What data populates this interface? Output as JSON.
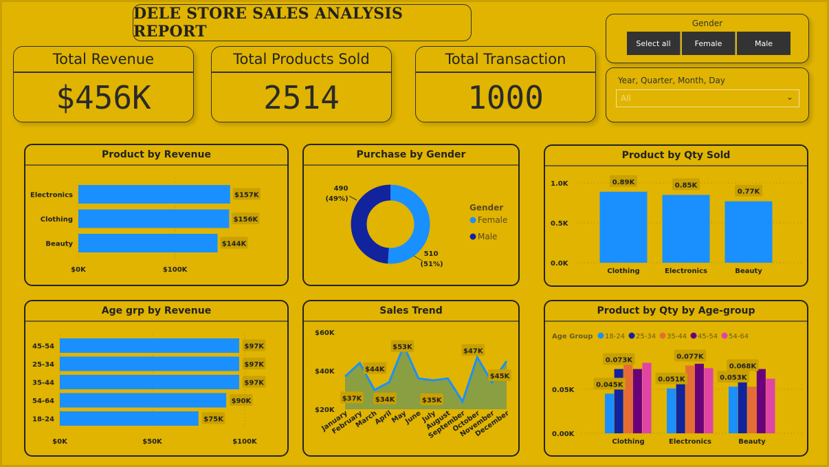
{
  "header": {
    "title": "DELE STORE SALES ANALYSIS REPORT"
  },
  "kpis": [
    {
      "label": "Total Revenue",
      "value": "$456K"
    },
    {
      "label": "Total Products Sold",
      "value": "2514"
    },
    {
      "label": "Total Transaction",
      "value": "1000"
    }
  ],
  "gender_slicer": {
    "title": "Gender",
    "options": [
      "Select all",
      "Female",
      "Male"
    ]
  },
  "date_slicer": {
    "title": "Year, Quarter, Month, Day",
    "selected": "All"
  },
  "colors": {
    "background": "#e0b400",
    "bar_blue": "#1a90ff",
    "navy": "#12239e",
    "orange": "#e66c37",
    "purple": "#6b007b",
    "pink": "#e044a7"
  },
  "chart_data": [
    {
      "type": "bar",
      "orientation": "horizontal",
      "title": "Product by Revenue",
      "categories": [
        "Electronics",
        "Clothing",
        "Beauty"
      ],
      "values": [
        157000,
        156000,
        144000
      ],
      "data_labels": [
        "$157K",
        "$156K",
        "$144K"
      ],
      "xticks": [
        "$0K",
        "$100K"
      ],
      "xlim": [
        0,
        160000
      ],
      "color": "#1a90ff"
    },
    {
      "type": "pie",
      "donut": true,
      "title": "Purchase by Gender",
      "legend_title": "Gender",
      "categories": [
        "Female",
        "Male"
      ],
      "values": [
        510,
        490
      ],
      "data_labels": [
        "510",
        "490"
      ],
      "percent_labels": [
        "(51%)",
        "(49%)"
      ],
      "colors": [
        "#1a90ff",
        "#12239e"
      ],
      "legend": "right"
    },
    {
      "type": "bar",
      "orientation": "vertical",
      "title": "Product by Qty Sold",
      "categories": [
        "Clothing",
        "Electronics",
        "Beauty"
      ],
      "values": [
        890,
        850,
        770
      ],
      "data_labels": [
        "0.89K",
        "0.85K",
        "0.77K"
      ],
      "yticks": [
        "0.0K",
        "0.5K",
        "1.0K"
      ],
      "ylim": [
        0,
        1000
      ],
      "color": "#1a90ff"
    },
    {
      "type": "bar",
      "orientation": "horizontal",
      "title": "Age grp by Revenue",
      "categories": [
        "45-54",
        "25-34",
        "35-44",
        "54-64",
        "18-24"
      ],
      "values": [
        97000,
        97000,
        97000,
        90000,
        75000
      ],
      "data_labels": [
        "$97K",
        "$97K",
        "$97K",
        "$90K",
        "$75K"
      ],
      "xticks": [
        "$0K",
        "$50K",
        "$100K"
      ],
      "xlim": [
        0,
        100000
      ],
      "color": "#1a90ff"
    },
    {
      "type": "area",
      "title": "Sales Trend",
      "categories": [
        "January",
        "February",
        "March",
        "April",
        "May",
        "June",
        "July",
        "August",
        "September",
        "October",
        "November",
        "December"
      ],
      "values": [
        37000,
        44000,
        30000,
        34000,
        53000,
        36000,
        35000,
        36000,
        24000,
        47000,
        34000,
        45000
      ],
      "data_labels": [
        {
          "index": 0,
          "text": "$37K"
        },
        {
          "index": 1,
          "text": "$44K"
        },
        {
          "index": 3,
          "text": "$34K"
        },
        {
          "index": 4,
          "text": "$53K"
        },
        {
          "index": 6,
          "text": "$35K"
        },
        {
          "index": 9,
          "text": "$47K"
        },
        {
          "index": 11,
          "text": "$45K"
        }
      ],
      "yticks": [
        "$20K",
        "$40K",
        "$60K"
      ],
      "ylim": [
        20000,
        60000
      ],
      "line_color": "#1a90ff",
      "area_color": "#7a9a4e"
    },
    {
      "type": "bar",
      "orientation": "vertical",
      "grouped": true,
      "title": "Product by Qty by Age-group",
      "legend_title": "Age Group",
      "categories": [
        "Clothing",
        "Electronics",
        "Beauty"
      ],
      "series": [
        {
          "name": "18-24",
          "color": "#1a90ff",
          "values": [
            0.045,
            0.051,
            0.053
          ]
        },
        {
          "name": "25-34",
          "color": "#12239e",
          "values": [
            0.073,
            0.062,
            0.066
          ]
        },
        {
          "name": "35-44",
          "color": "#e66c37",
          "values": [
            0.08,
            0.077,
            0.053
          ]
        },
        {
          "name": "45-54",
          "color": "#6b007b",
          "values": [
            0.073,
            0.079,
            0.073
          ]
        },
        {
          "name": "54-64",
          "color": "#e044a7",
          "values": [
            0.08,
            0.074,
            0.062
          ]
        }
      ],
      "data_labels": [
        {
          "text": "0.045K",
          "category": 0,
          "series": 0
        },
        {
          "text": "0.073K",
          "category": 0,
          "series": 1
        },
        {
          "text": "0.051K",
          "category": 1,
          "series": 0
        },
        {
          "text": "0.077K",
          "category": 1,
          "series": 2
        },
        {
          "text": "0.053K",
          "category": 2,
          "series": 0
        },
        {
          "text": "0.068K",
          "category": 2,
          "series": 1
        }
      ],
      "yticks": [
        "0.00K",
        "0.05K"
      ],
      "ylim": [
        0,
        0.1
      ],
      "legend": "top-left"
    }
  ]
}
